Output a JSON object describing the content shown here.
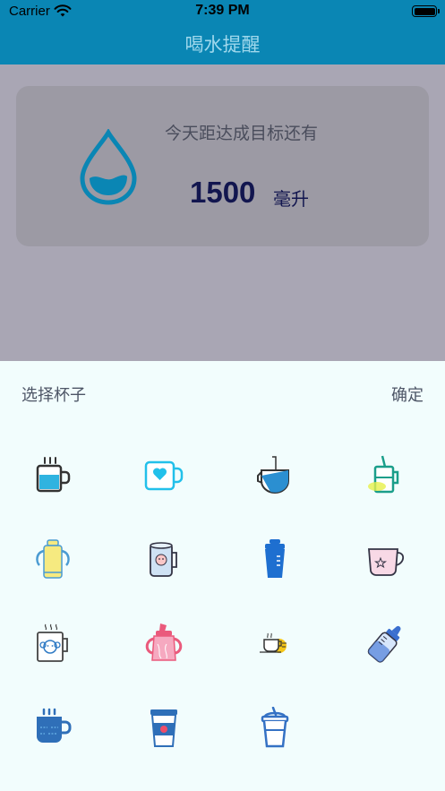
{
  "status_bar": {
    "carrier": "Carrier",
    "time": "7:39 PM"
  },
  "nav": {
    "title": "喝水提醒"
  },
  "card": {
    "goal_text": "今天距达成目标还有",
    "amount": "1500",
    "unit": "毫升"
  },
  "sheet": {
    "title": "选择杯子",
    "confirm": "确定",
    "cups": [
      "coffee-mug-icon",
      "heart-mug-icon",
      "glass-cup-icon",
      "straw-glass-icon",
      "sippy-bottle-icon",
      "face-jar-icon",
      "shaker-bottle-icon",
      "star-mug-icon",
      "monkey-mug-icon",
      "pink-sippy-icon",
      "small-tea-cup-icon",
      "baby-bottle-icon",
      "steaming-mug-icon",
      "paper-coffee-cup-icon",
      "drink-cup-with-straw-icon"
    ]
  },
  "colors": {
    "header": "#0a86b4",
    "overlay": "#a9a6b4",
    "sheet": "#f2fdfd",
    "amount": "#12164f"
  }
}
